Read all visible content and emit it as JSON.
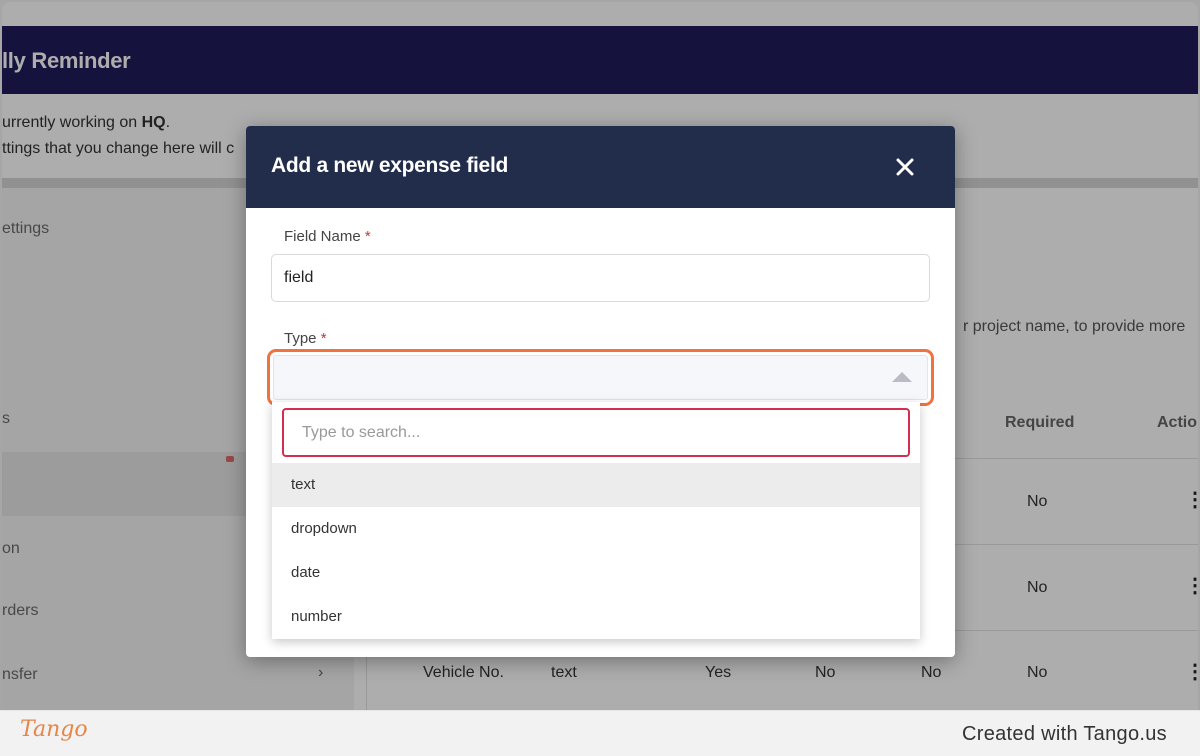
{
  "app": {
    "header_title": "lly Reminder",
    "info_line1_prefix": "urrently working on ",
    "info_line1_bold": "HQ",
    "info_line1_suffix": ".",
    "info_line2": "ttings that you change here will c"
  },
  "sidebar": {
    "items": [
      {
        "label": "ettings"
      },
      {
        "label": "s"
      },
      {
        "label": "on"
      },
      {
        "label": "rders"
      },
      {
        "label": "nsfer"
      }
    ],
    "chevron": "›"
  },
  "main": {
    "description": "r project name, to provide more",
    "headers": {
      "required": "Required",
      "actions": "Actio"
    },
    "rows": [
      {
        "required": "No"
      },
      {
        "required": "No"
      },
      {
        "name": "Vehicle No.",
        "type": "text",
        "col3": "Yes",
        "col4": "No",
        "col5": "No",
        "required": "No"
      }
    ]
  },
  "modal": {
    "title": "Add a new expense field",
    "close_symbol": "✕",
    "field_name_label": "Field Name",
    "required_mark": "*",
    "field_name_value": "field",
    "type_label": "Type",
    "search_placeholder": "Type to search...",
    "options": [
      "text",
      "dropdown",
      "date",
      "number"
    ],
    "highlighted_option": "text"
  },
  "footer": {
    "logo": "Tango",
    "created_with": "Created with Tango.us"
  },
  "colors": {
    "app_header": "#1f1c5c",
    "modal_header": "#222c4b",
    "focus_ring": "#f0723e",
    "search_border": "#d32f4f",
    "tango_orange": "#e6864a"
  }
}
